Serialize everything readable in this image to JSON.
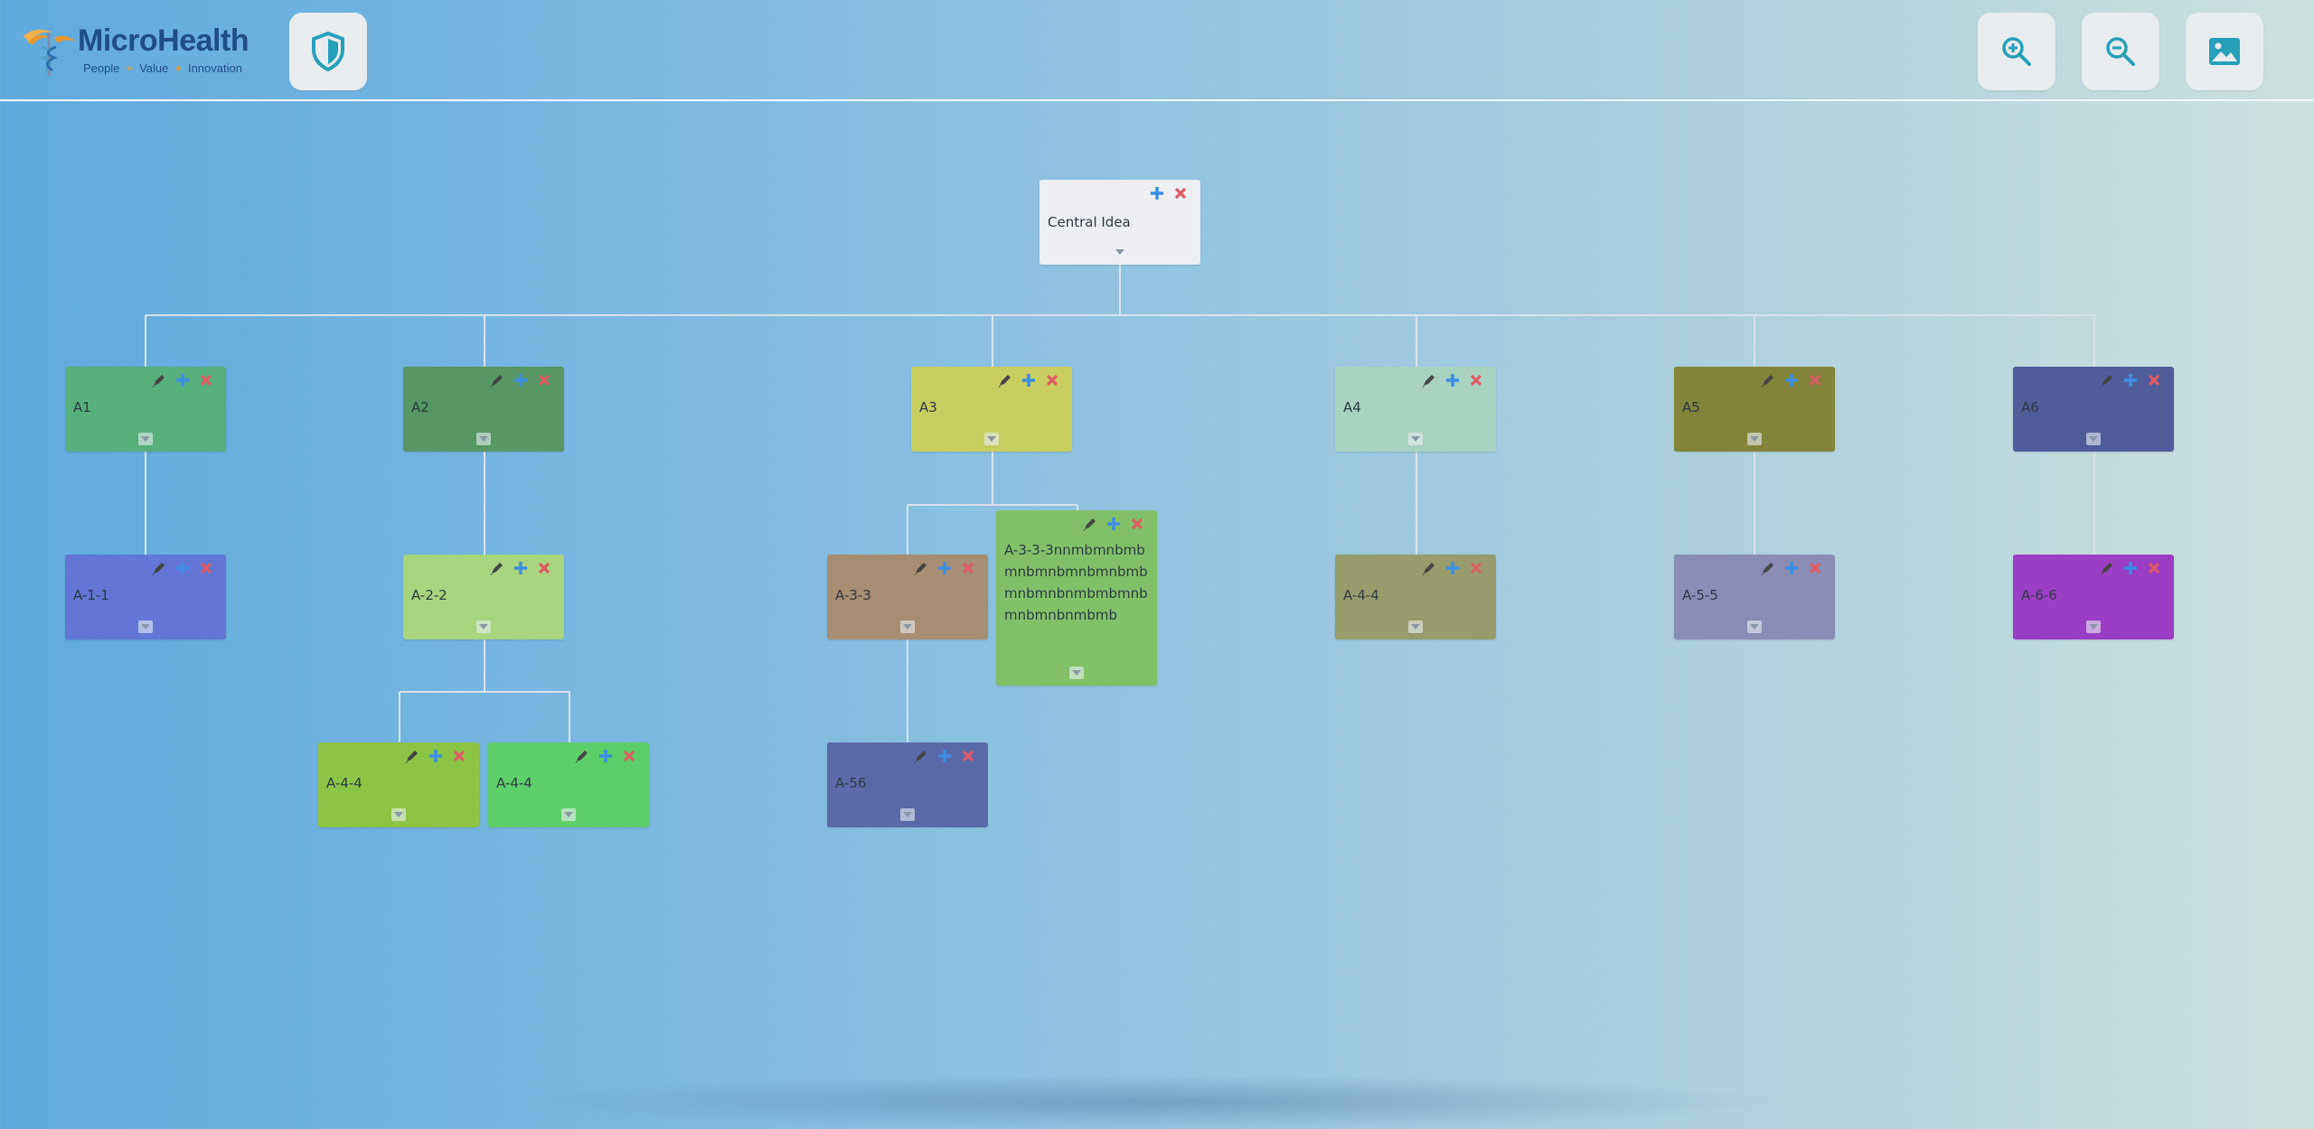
{
  "header": {
    "logo_name": "MicroHealth",
    "logo_tagline": [
      "People",
      "Value",
      "Innovation"
    ]
  },
  "toolbar": {
    "shield": {
      "icon": "shield-icon"
    },
    "zoom_in": {
      "icon": "zoom-in-icon"
    },
    "zoom_out": {
      "icon": "zoom-out-icon"
    },
    "export_image": {
      "icon": "image-icon"
    }
  },
  "colors": {
    "accent": "#26a0b8",
    "add": "#3c8ee6",
    "delete": "#e05a62",
    "edit": "#454545"
  },
  "mindmap": {
    "root": {
      "label": "Central Idea"
    },
    "nodes": [
      {
        "id": "a1",
        "label": "A1",
        "color": "#55b07c"
      },
      {
        "id": "a2",
        "label": "A2",
        "color": "#579765"
      },
      {
        "id": "a3",
        "label": "A3",
        "color": "#c8cd5f"
      },
      {
        "id": "a4",
        "label": "A4",
        "color": "#a9d1c0"
      },
      {
        "id": "a5",
        "label": "A5",
        "color": "#828439"
      },
      {
        "id": "a6",
        "label": "A6",
        "color": "#505c9a"
      },
      {
        "id": "a11",
        "label": "A-1-1",
        "color": "#6376d6"
      },
      {
        "id": "a22",
        "label": "A-2-2",
        "color": "#a8d47d"
      },
      {
        "id": "a33",
        "label": "A-3-3",
        "color": "#a78d72"
      },
      {
        "id": "a333",
        "label": "A-3-3-3nnmbmnbmbmnbmnbmnbmnbmbmnbmnbnmbmbmnbmnbmnbnmbmb",
        "color": "#82c067"
      },
      {
        "id": "a44",
        "label": "A-4-4",
        "color": "#989b6c"
      },
      {
        "id": "a55",
        "label": "A-5-5",
        "color": "#8a8cb3"
      },
      {
        "id": "a66",
        "label": "A-6-6",
        "color": "#9c3dc6"
      },
      {
        "id": "a44b",
        "label": "A-4-4",
        "color": "#8cc545"
      },
      {
        "id": "a44c",
        "label": "A-4-4",
        "color": "#5dcf69"
      },
      {
        "id": "a56",
        "label": "A-56",
        "color": "#5b69ab"
      }
    ]
  }
}
